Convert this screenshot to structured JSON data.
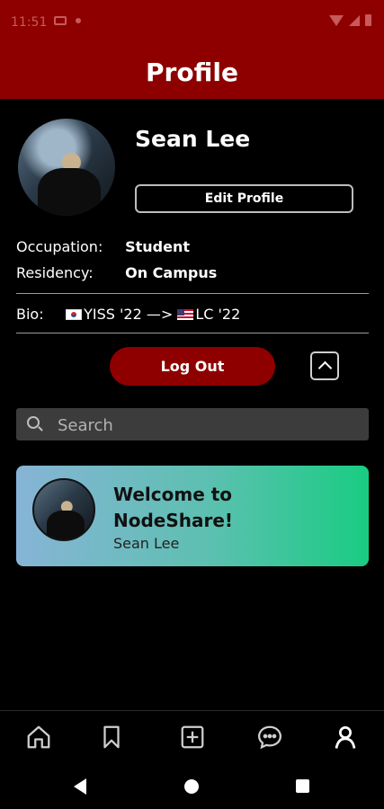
{
  "status_bar": {
    "time": "11:51"
  },
  "header": {
    "title": "Profile"
  },
  "profile": {
    "name": "Sean Lee",
    "edit_button_label": "Edit Profile",
    "occupation_label": "Occupation:",
    "occupation_value": "Student",
    "residency_label": "Residency:",
    "residency_value": "On Campus",
    "bio_label": "Bio:",
    "bio_text_1": "YISS '22 —> ",
    "bio_text_2": "LC '22"
  },
  "actions": {
    "logout_label": "Log Out"
  },
  "search": {
    "placeholder": "Search"
  },
  "posts": [
    {
      "title": "Welcome to NodeShare!",
      "author": "Sean Lee"
    }
  ],
  "bottom_nav": {
    "items": [
      "home-icon",
      "bookmark-icon",
      "add-post-icon",
      "chat-icon",
      "profile-icon"
    ],
    "active": "profile-icon"
  },
  "colors": {
    "brand": "#8e0000",
    "background": "#000000",
    "card_gradient_start": "#87b4d6",
    "card_gradient_end": "#19cc82"
  }
}
